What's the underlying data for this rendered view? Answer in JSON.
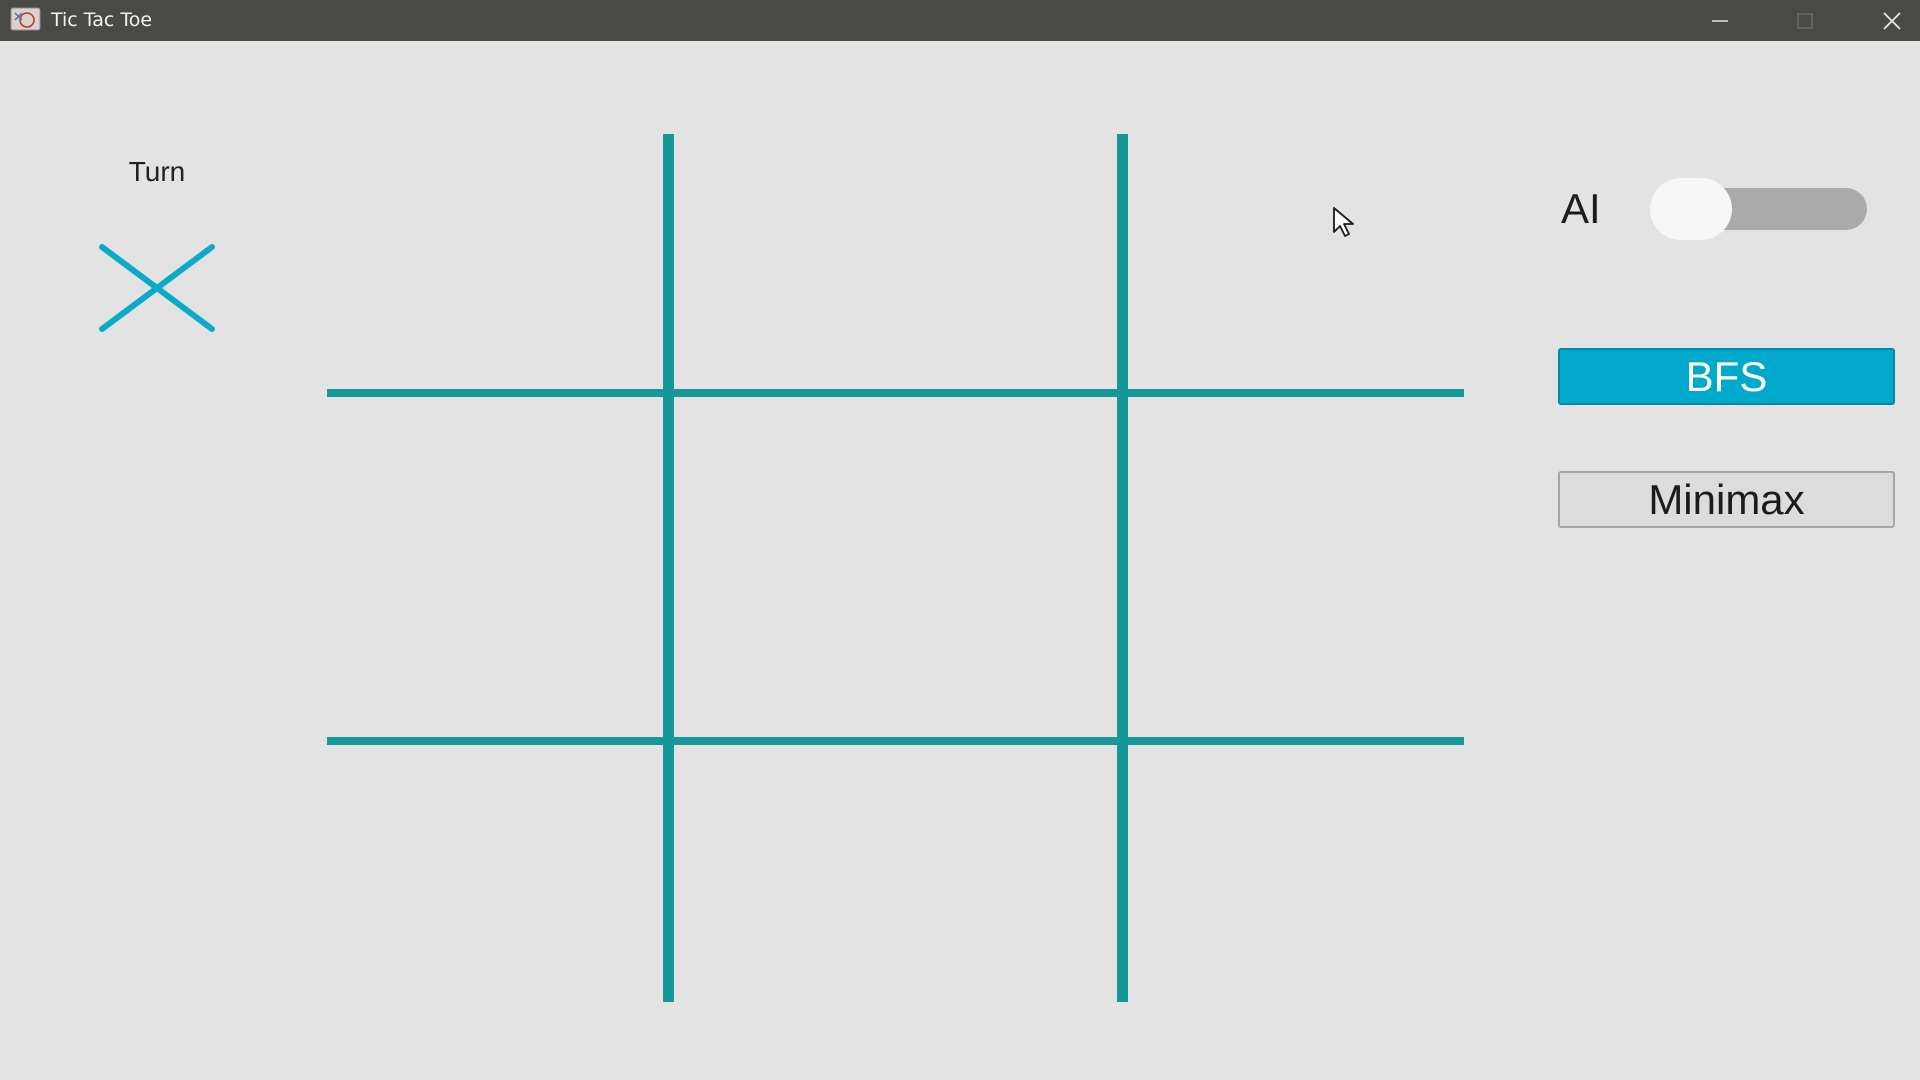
{
  "window": {
    "title": "Tic Tac Toe",
    "app_icon": "tic-tac-toe-app-icon",
    "controls": {
      "minimize_icon": "minimize-icon",
      "maximize_icon": "maximize-icon",
      "close_icon": "close-icon"
    }
  },
  "turn": {
    "label": "Turn",
    "current_player": "X",
    "mark_icon": "x-mark-icon"
  },
  "board": {
    "rows": 3,
    "cols": 3,
    "cells": [
      [
        "",
        "",
        ""
      ],
      [
        "",
        "",
        ""
      ],
      [
        "",
        "",
        ""
      ]
    ],
    "grid_color": "#17979a"
  },
  "ai": {
    "label": "AI",
    "enabled": false
  },
  "algorithms": {
    "bfs_label": "BFS",
    "minimax_label": "Minimax",
    "selected": "BFS"
  },
  "colors": {
    "accent": "#00a8cc",
    "background": "#e3e3e3",
    "titlebar": "#494946",
    "x_mark": "#0aa9c8"
  }
}
